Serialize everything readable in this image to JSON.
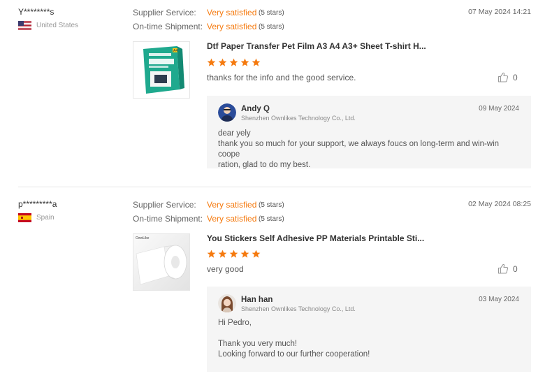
{
  "reviews": [
    {
      "name": "Y********s",
      "country": "United States",
      "supplier_label": "Supplier Service:",
      "supplier_value": "Very satisfied",
      "supplier_stars": "(5 stars)",
      "shipment_label": "On-time Shipment:",
      "shipment_value": "Very satisfied",
      "shipment_stars": "(5 stars)",
      "date": "07 May 2024 14:21",
      "product_title": "Dtf Paper Transfer Pet Film A3 A4 A3+ Sheet T-shirt H...",
      "rating": 5,
      "comment": "thanks for the info and the good service.",
      "likes": "0",
      "reply": {
        "name": "Andy Q",
        "company": "Shenzhen Ownlikes Technology Co., Ltd.",
        "date": "09 May 2024",
        "text": "dear yely\nthank you so much for your support, we always foucs on long-term and win-win coope\nration, glad to do my best."
      }
    },
    {
      "name": "p*********a",
      "country": "Spain",
      "supplier_label": "Supplier Service:",
      "supplier_value": "Very satisfied",
      "supplier_stars": "(5 stars)",
      "shipment_label": "On-time Shipment:",
      "shipment_value": "Very satisfied",
      "shipment_stars": "(5 stars)",
      "date": "02 May 2024 08:25",
      "product_title": "You Stickers Self Adhesive PP Materials Printable Sti...",
      "rating": 5,
      "comment": "very good",
      "likes": "0",
      "reply": {
        "name": "Han han",
        "company": "Shenzhen Ownlikes Technology Co., Ltd.",
        "date": "03 May 2024",
        "text": "Hi Pedro,\n\nThank you very much!\nLooking forward to our further cooperation!"
      }
    }
  ],
  "colors": {
    "accent": "#f57a0f",
    "reply_bg": "#f5f5f5"
  },
  "thumb_text": {
    "product1_badge": "A4",
    "product2_brand": "OwnLike"
  }
}
